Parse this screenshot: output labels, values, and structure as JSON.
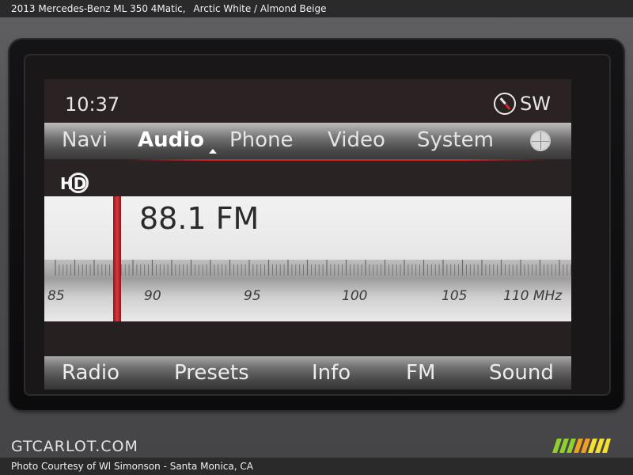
{
  "caption": {
    "vehicle": "2013 Mercedes-Benz ML 350 4Matic,",
    "color": "Arctic White / Almond Beige"
  },
  "status": {
    "time": "10:37",
    "heading": "SW"
  },
  "tabs": [
    {
      "label": "Navi"
    },
    {
      "label": "Audio"
    },
    {
      "label": "Phone"
    },
    {
      "label": "Video"
    },
    {
      "label": "System"
    }
  ],
  "active_tab": "Audio",
  "badge": "HD",
  "tuner": {
    "frequency": "88.1 FM",
    "value": 88.1,
    "scale_labels": [
      "85",
      "90",
      "95",
      "100",
      "105",
      "110 MHz"
    ]
  },
  "softkeys": [
    {
      "label": "Radio"
    },
    {
      "label": "Presets"
    },
    {
      "label": "Info"
    },
    {
      "label": "FM"
    },
    {
      "label": "Sound"
    }
  ],
  "watermark": "GTCARLOT.COM",
  "credit": "Photo Courtesy of Wl Simonson - Santa Monica, CA",
  "colors": {
    "accent_red": "#d0262a",
    "stripe_green": "#8fcf2f",
    "stripe_orange": "#f0a020",
    "stripe_yellow": "#f4e030"
  }
}
